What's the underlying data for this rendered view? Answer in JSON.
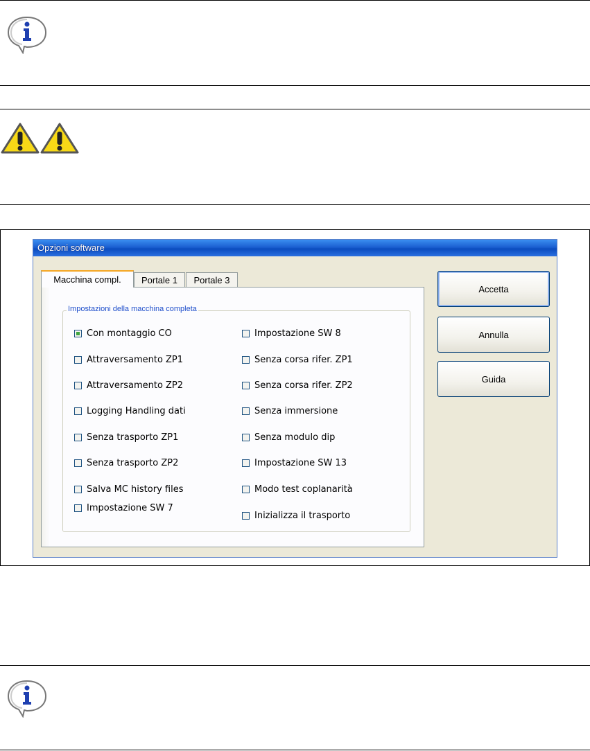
{
  "window": {
    "title": "Opzioni software"
  },
  "tabs": [
    {
      "label": "Macchina compl.",
      "active": true
    },
    {
      "label": "Portale 1",
      "active": false
    },
    {
      "label": "Portale 3",
      "active": false
    }
  ],
  "group": {
    "title": "Impostazioni della macchina completa",
    "left_column": [
      {
        "label": "Con montaggio CO",
        "checked": true
      },
      {
        "label": "Attraversamento ZP1",
        "checked": false
      },
      {
        "label": "Attraversamento ZP2",
        "checked": false
      },
      {
        "label": "Logging Handling dati",
        "checked": false
      },
      {
        "label": "Senza trasporto ZP1",
        "checked": false
      },
      {
        "label": "Senza trasporto ZP2",
        "checked": false
      },
      {
        "label": "Salva MC history files",
        "checked": false
      },
      {
        "label": "Impostazione SW 7",
        "checked": false
      }
    ],
    "right_column": [
      {
        "label": "Impostazione SW 8",
        "checked": false
      },
      {
        "label": "Senza corsa rifer. ZP1",
        "checked": false
      },
      {
        "label": "Senza corsa rifer. ZP2",
        "checked": false
      },
      {
        "label": "Senza immersione",
        "checked": false
      },
      {
        "label": "Senza modulo dip",
        "checked": false
      },
      {
        "label": "Impostazione SW 13",
        "checked": false
      },
      {
        "label": "Modo test coplanarità",
        "checked": false
      },
      {
        "label": "Inizializza il trasporto",
        "checked": false
      }
    ]
  },
  "buttons": {
    "accept": "Accetta",
    "cancel": "Annulla",
    "help": "Guida"
  },
  "icons": {
    "info_top": "info-icon",
    "warning_1": "warning-icon",
    "warning_2": "warning-icon",
    "info_bottom": "info-icon"
  },
  "colors": {
    "titlebar": "#0b4cbf",
    "window_bg": "#ece9d8",
    "tab_accent": "#f5a623",
    "group_title": "#1f4fcb",
    "check_fill": "#3fa53f",
    "warning_yellow": "#f7d917"
  }
}
